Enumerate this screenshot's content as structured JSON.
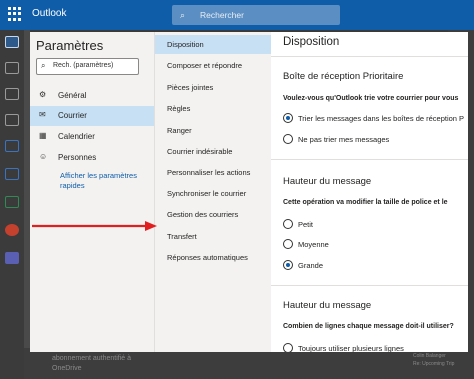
{
  "header": {
    "app_name": "Outlook",
    "search_placeholder": "Rechercher"
  },
  "background": {
    "list_line1": "abonnement authentifié à",
    "list_line2": "OneDrive",
    "preview_line1": "Colin Balanger",
    "preview_line2": "Re: Upcoming Trip"
  },
  "settings": {
    "title": "Paramètres",
    "search_placeholder": "Rech. (paramètres)",
    "nav": [
      {
        "label": "Général",
        "icon": "gear-icon"
      },
      {
        "label": "Courrier",
        "icon": "mail-icon"
      },
      {
        "label": "Calendrier",
        "icon": "calendar-icon"
      },
      {
        "label": "Personnes",
        "icon": "people-icon"
      }
    ],
    "quick_settings": "Afficher les paramètres rapides",
    "submenu": [
      "Disposition",
      "Composer et répondre",
      "Pièces jointes",
      "Règles",
      "Ranger",
      "Courrier indésirable",
      "Personnaliser les actions",
      "Synchroniser le courrier",
      "Gestion des courriers",
      "Transfert",
      "Réponses automatiques"
    ]
  },
  "disposition": {
    "title": "Disposition",
    "focused_inbox": {
      "title": "Boîte de réception Prioritaire",
      "question": "Voulez-vous qu'Outlook trie votre courrier pour vous",
      "options": [
        "Trier les messages dans les boîtes de réception P",
        "Ne pas trier mes messages"
      ],
      "selected": 0
    },
    "message_height": {
      "title": "Hauteur du message",
      "question": "Cette opération va modifier la taille de police et le",
      "options": [
        "Petit",
        "Moyenne",
        "Grande"
      ],
      "selected": 2
    },
    "message_lines": {
      "title": "Hauteur du message",
      "question": "Combien de lignes chaque message doit-il utiliser?",
      "options": [
        "Toujours utiliser plusieurs lignes"
      ]
    }
  },
  "colors": {
    "brand": "#0f5da9",
    "selected": "#c7e0f4",
    "arrow": "#e02020"
  }
}
